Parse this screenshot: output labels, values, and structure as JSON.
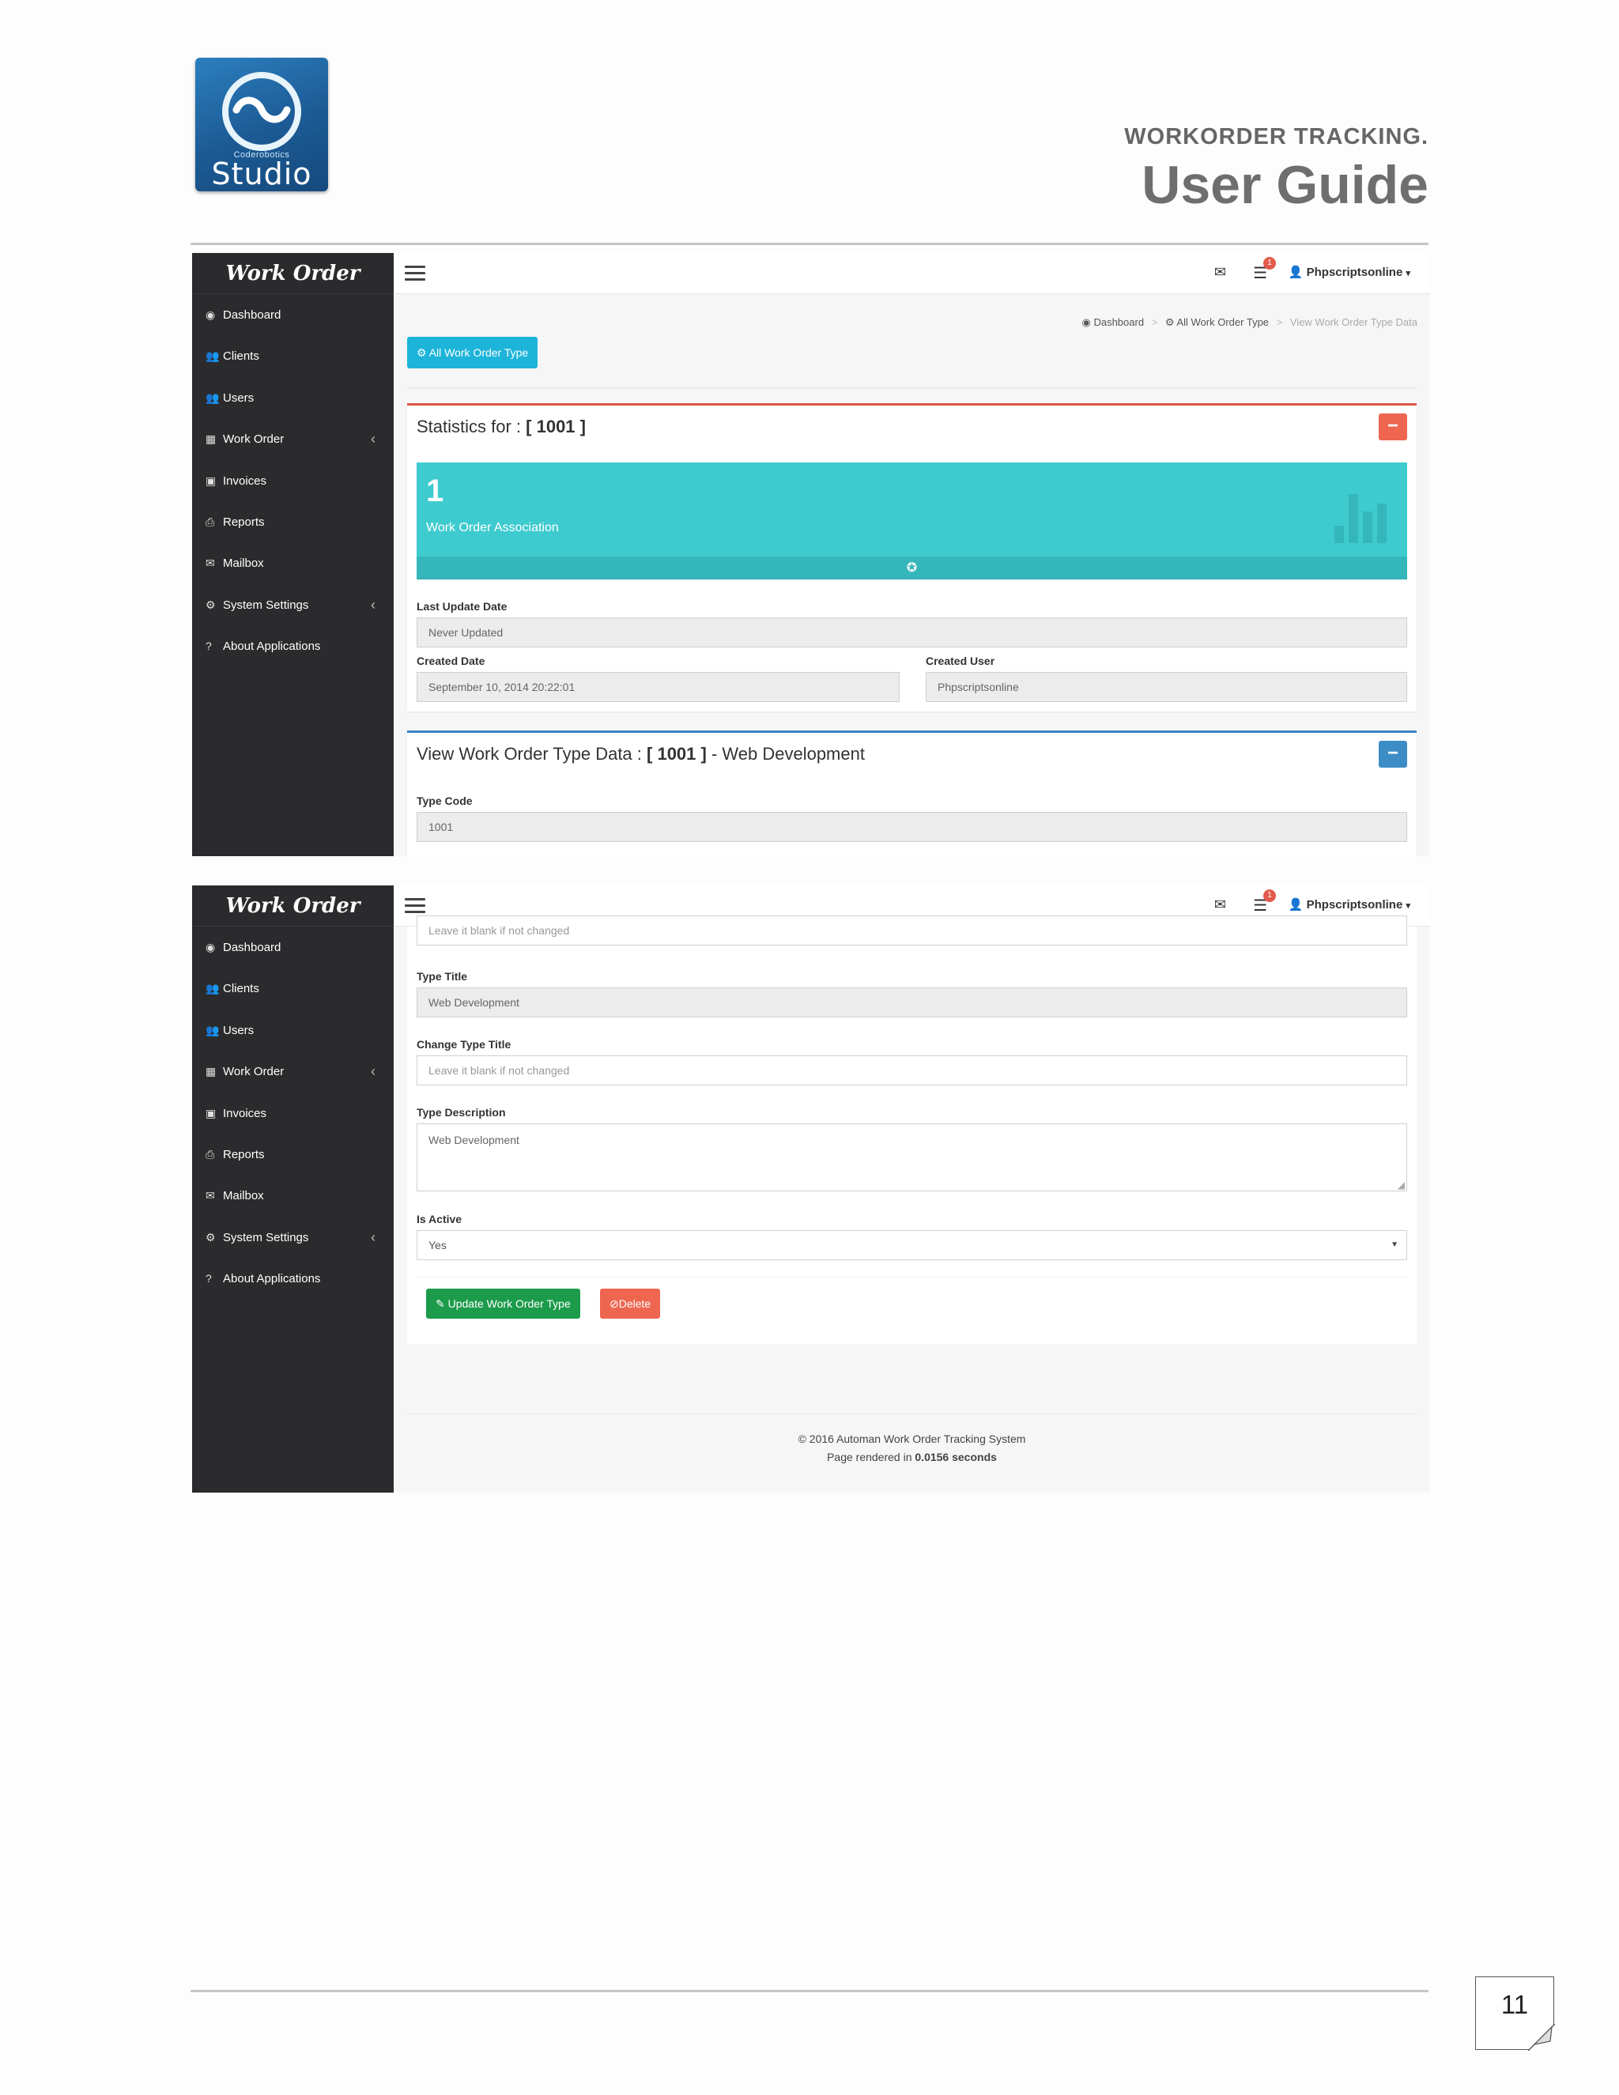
{
  "doc": {
    "logo_sub": "Coderobotics",
    "logo_main": "Studio",
    "title_small": "WORKORDER TRACKING.",
    "title_big": "User Guide",
    "page_number": "11"
  },
  "app": {
    "brand": "Work Order",
    "user": "Phpscriptsonline",
    "notification_count": "1",
    "nav": [
      {
        "label": "Dashboard",
        "icon": "dashboard-icon",
        "has_submenu": false
      },
      {
        "label": "Clients",
        "icon": "users-icon",
        "has_submenu": false
      },
      {
        "label": "Users",
        "icon": "users-icon",
        "has_submenu": false
      },
      {
        "label": "Work Order",
        "icon": "chart-icon",
        "has_submenu": true
      },
      {
        "label": "Invoices",
        "icon": "money-icon",
        "has_submenu": false
      },
      {
        "label": "Reports",
        "icon": "print-icon",
        "has_submenu": false
      },
      {
        "label": "Mailbox",
        "icon": "envelope-icon",
        "has_submenu": false
      },
      {
        "label": "System Settings",
        "icon": "cogs-icon",
        "has_submenu": true
      },
      {
        "label": "About Applications",
        "icon": "question-icon",
        "has_submenu": false
      }
    ]
  },
  "screen1": {
    "breadcrumb": [
      "Dashboard",
      "All Work Order Type",
      "View Work Order Type Data"
    ],
    "all_button": "All Work Order Type",
    "stats_title_prefix": "Statistics for : ",
    "stats_title_value": "[ 1001 ]",
    "stat_number": "1",
    "stat_label": "Work Order Association",
    "last_update_label": "Last Update Date",
    "last_update_value": "Never Updated",
    "created_date_label": "Created Date",
    "created_date_value": "September 10, 2014 20:22:01",
    "created_user_label": "Created User",
    "created_user_value": "Phpscriptsonline",
    "view_title_prefix": "View Work Order Type Data : ",
    "view_title_value": "[ 1001 ]",
    "view_title_suffix": " - Web Development",
    "type_code_label": "Type Code",
    "type_code_value": "1001"
  },
  "screen2": {
    "change_code_placeholder": "Leave it blank if not changed",
    "type_title_label": "Type Title",
    "type_title_value": "Web Development",
    "change_title_label": "Change Type Title",
    "change_title_placeholder": "Leave it blank if not changed",
    "type_desc_label": "Type Description",
    "type_desc_value": "Web Development",
    "is_active_label": "Is Active",
    "is_active_value": "Yes",
    "update_button": "Update Work Order Type",
    "delete_button": "Delete",
    "footer_line1": "© 2016 Automan Work Order Tracking System",
    "footer_line2_prefix": "Page rendered in ",
    "footer_line2_value": "0.0156 seconds"
  },
  "colors": {
    "sidebar": "#2b2b2d",
    "accent_info": "#1cb4d9",
    "stat_box": "#3ecbcf",
    "danger": "#ee6650",
    "success": "#1c9b4b"
  }
}
